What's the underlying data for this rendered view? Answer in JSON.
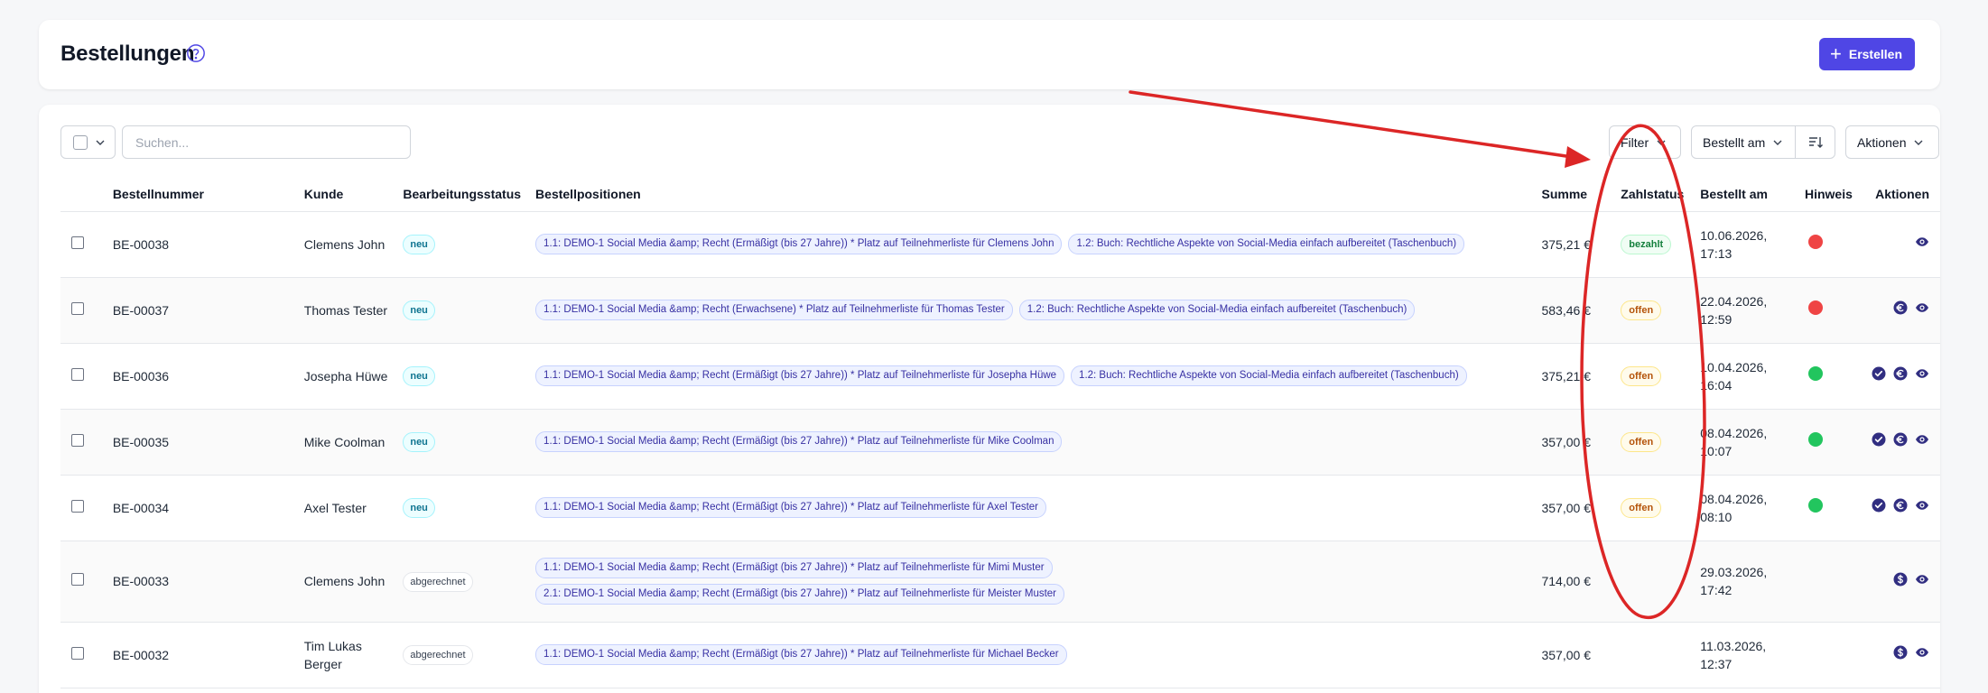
{
  "header": {
    "title": "Bestellungen",
    "create_label": "Erstellen"
  },
  "toolbar": {
    "search_placeholder": "Suchen...",
    "filter_label": "Filter",
    "sort_label": "Bestellt am",
    "actions_label": "Aktionen"
  },
  "table": {
    "columns": {
      "number": "Bestellnummer",
      "customer": "Kunde",
      "status": "Bearbeitungsstatus",
      "positions": "Bestellpositionen",
      "sum": "Summe",
      "payment": "Zahlstatus",
      "ordered": "Bestellt am",
      "hint": "Hinweis",
      "actions": "Aktionen"
    },
    "rows": [
      {
        "number": "BE-00038",
        "customer": "Clemens John",
        "status": "neu",
        "positions": [
          "1.1: DEMO-1 Social Media &amp; Recht (Ermäßigt (bis 27 Jahre)) * Platz auf Teilnehmerliste für Clemens John",
          "1.2: Buch: Rechtliche Aspekte von Social-Media einfach aufbereitet (Taschenbuch)"
        ],
        "sum": "375,21 €",
        "payment": "bezahlt",
        "ordered": "10.06.2026, 17:13",
        "hint": "red"
      },
      {
        "number": "BE-00037",
        "customer": "Thomas Tester",
        "status": "neu",
        "positions": [
          "1.1: DEMO-1 Social Media &amp; Recht (Erwachsene) * Platz auf Teilnehmerliste für Thomas Tester",
          "1.2: Buch: Rechtliche Aspekte von Social-Media einfach aufbereitet (Taschenbuch)"
        ],
        "sum": "583,46 €",
        "payment": "offen",
        "ordered": "22.04.2026, 12:59",
        "hint": "red"
      },
      {
        "number": "BE-00036",
        "customer": "Josepha Hüwe",
        "status": "neu",
        "positions": [
          "1.1: DEMO-1 Social Media &amp; Recht (Ermäßigt (bis 27 Jahre)) * Platz auf Teilnehmerliste für Josepha Hüwe",
          "1.2: Buch: Rechtliche Aspekte von Social-Media einfach aufbereitet (Taschenbuch)"
        ],
        "sum": "375,21 €",
        "payment": "offen",
        "ordered": "10.04.2026, 16:04",
        "hint": "green"
      },
      {
        "number": "BE-00035",
        "customer": "Mike Coolman",
        "status": "neu",
        "positions": [
          "1.1: DEMO-1 Social Media &amp; Recht (Ermäßigt (bis 27 Jahre)) * Platz auf Teilnehmerliste für Mike Coolman"
        ],
        "sum": "357,00 €",
        "payment": "offen",
        "ordered": "08.04.2026, 10:07",
        "hint": "green"
      },
      {
        "number": "BE-00034",
        "customer": "Axel Tester",
        "status": "neu",
        "positions": [
          "1.1: DEMO-1 Social Media &amp; Recht (Ermäßigt (bis 27 Jahre)) * Platz auf Teilnehmerliste für Axel Tester"
        ],
        "sum": "357,00 €",
        "payment": "offen",
        "ordered": "08.04.2026, 08:10",
        "hint": "green"
      },
      {
        "number": "BE-00033",
        "customer": "Clemens John",
        "status": "abgerechnet",
        "positions": [
          "1.1: DEMO-1 Social Media &amp; Recht (Ermäßigt (bis 27 Jahre)) * Platz auf Teilnehmerliste für Mimi Muster",
          "2.1: DEMO-1 Social Media &amp; Recht (Ermäßigt (bis 27 Jahre)) * Platz auf Teilnehmerliste für Meister Muster"
        ],
        "sum": "714,00 €",
        "payment": "",
        "ordered": "29.03.2026, 17:42",
        "hint": ""
      },
      {
        "number": "BE-00032",
        "customer": "Tim Lukas Berger",
        "status": "abgerechnet",
        "positions": [
          "1.1: DEMO-1 Social Media &amp; Recht (Ermäßigt (bis 27 Jahre)) * Platz auf Teilnehmerliste für Michael Becker"
        ],
        "sum": "357,00 €",
        "payment": "",
        "ordered": "11.03.2026, 12:37",
        "hint": ""
      }
    ]
  },
  "colors": {
    "accent": "#4f46e5",
    "hint_red": "#ef4444",
    "hint_green": "#22c55e",
    "annotation_red": "#dc2626",
    "action_icon": "#312e81"
  }
}
